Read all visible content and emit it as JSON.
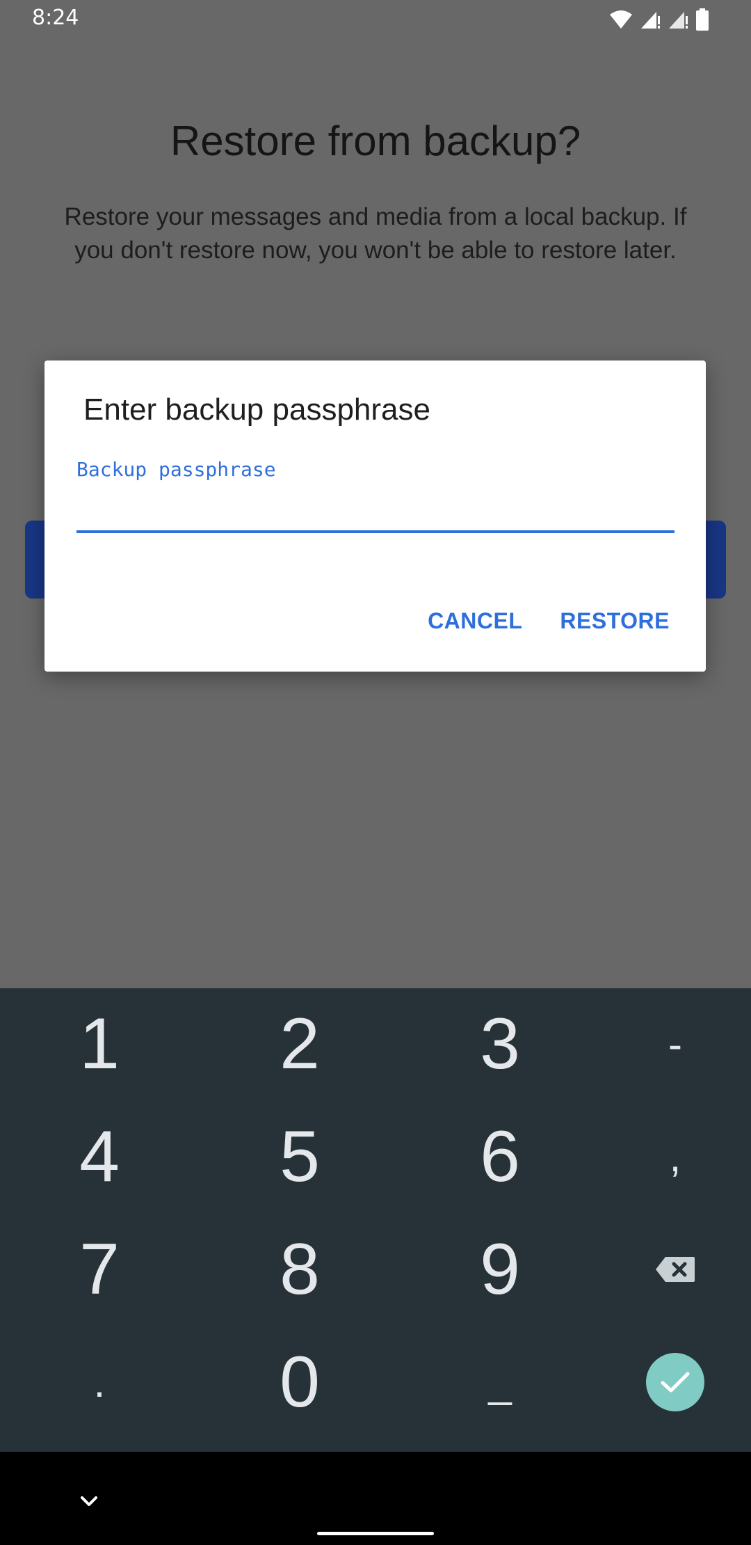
{
  "status_bar": {
    "time": "8:24",
    "icons": [
      "wifi-icon",
      "signal-icon",
      "signal-icon",
      "battery-icon"
    ]
  },
  "background": {
    "title": "Restore from backup?",
    "description": "Restore your messages and media from a local backup. If you don't restore now, you won't be able to restore later."
  },
  "dialog": {
    "title": "Enter backup passphrase",
    "input_label": "Backup passphrase",
    "input_value": "",
    "cancel_label": "CANCEL",
    "restore_label": "RESTORE",
    "accent_color": "#2f6fdc"
  },
  "keyboard": {
    "rows": [
      [
        "1",
        "2",
        "3",
        "-"
      ],
      [
        "4",
        "5",
        "6",
        ","
      ],
      [
        "7",
        "8",
        "9",
        "delete-icon"
      ],
      [
        ".",
        "0",
        "_",
        "done-icon"
      ]
    ],
    "background_color": "#263238",
    "done_color": "#80cbc4"
  },
  "nav_bar": {
    "icons": [
      "chevron-down-icon",
      "home-pill"
    ]
  }
}
